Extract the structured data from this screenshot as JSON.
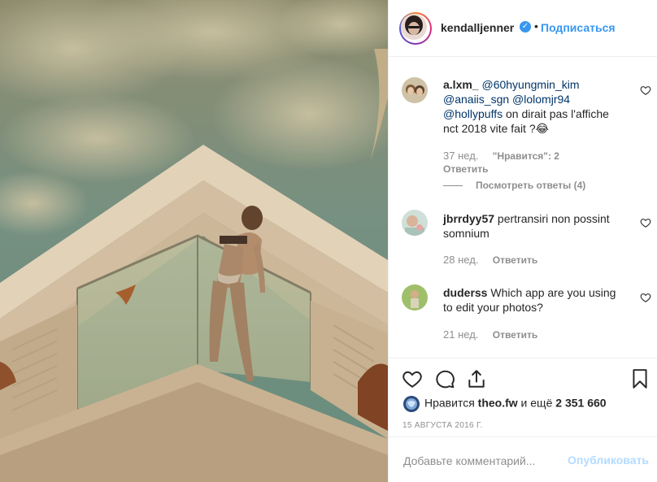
{
  "post": {
    "author": "kendalljenner",
    "separator": "•",
    "follow_label": "Подписаться",
    "verified_mark": "✓"
  },
  "comments": [
    {
      "username": "a.lxm_",
      "parts": [
        "@60hyungmin_kim",
        "@anaiis_sgn",
        "@lolomjr94",
        "@hollypuffs",
        " on dirait pas l'affiche nct 2018 vite fait ?😂"
      ],
      "time": "37 нед.",
      "likes": "\"Нравится\": 2",
      "reply_label": "Ответить",
      "view_replies": "Посмотреть ответы (4)"
    },
    {
      "username": "jbrrdyy57",
      "text": " pertransiri non possint somnium",
      "time": "28 нед.",
      "reply_label": "Ответить"
    },
    {
      "username": "duderss",
      "text": " Which app are you using to edit your photos?",
      "time": "21 нед.",
      "reply_label": "Ответить"
    }
  ],
  "likes": {
    "prefix": "Нравится ",
    "user": "theo.fw",
    "middle": " и ещё ",
    "count": "2 351 660"
  },
  "date": "15 АВГУСТА 2016 Г.",
  "comment_box": {
    "placeholder": "Добавьте комментарий...",
    "publish_label": "Опубликовать"
  },
  "icons": {
    "like": "heart-icon",
    "comment": "comment-icon",
    "share": "share-icon",
    "save": "bookmark-icon"
  },
  "colors": {
    "link": "#3897f0",
    "muted": "#8e8e8e",
    "publish_disabled": "#b3dbff"
  }
}
